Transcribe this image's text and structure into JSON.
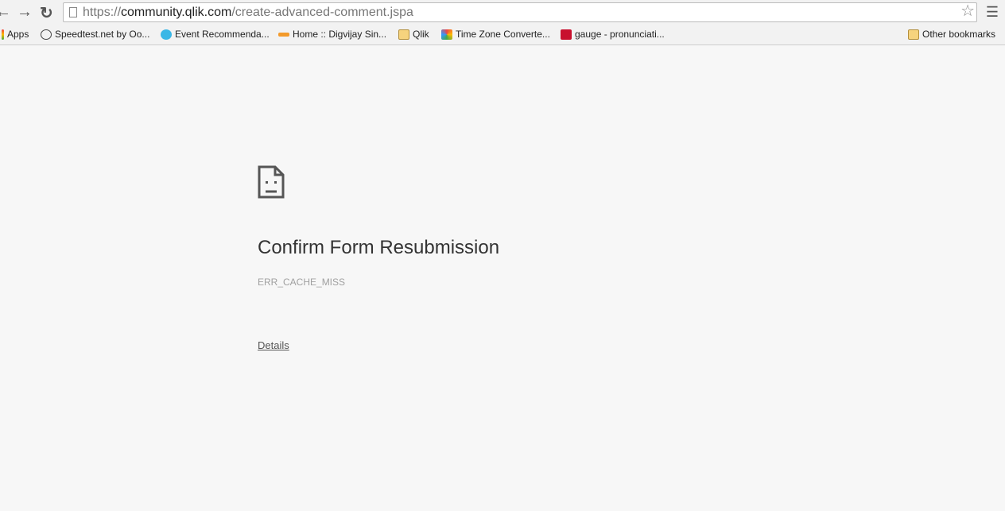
{
  "browser": {
    "url_scheme": "https://",
    "url_host": "community.qlik.com",
    "url_path": "/create-advanced-comment.jspa"
  },
  "bookmarks": [
    {
      "label": "Apps",
      "icon": "apps-icon"
    },
    {
      "label": "Speedtest.net by Oo...",
      "icon": "speedometer-icon"
    },
    {
      "label": "Event Recommenda...",
      "icon": "globe-icon"
    },
    {
      "label": "Home :: Digvijay Sin...",
      "icon": "key-icon"
    },
    {
      "label": "Qlik",
      "icon": "folder-icon"
    },
    {
      "label": "Time Zone Converte...",
      "icon": "clock-icon"
    },
    {
      "label": "gauge - pronunciati...",
      "icon": "dictionary-icon"
    }
  ],
  "other_bookmarks": "Other bookmarks",
  "error": {
    "title": "Confirm Form Resubmission",
    "code": "ERR_CACHE_MISS",
    "details_label": "Details"
  }
}
